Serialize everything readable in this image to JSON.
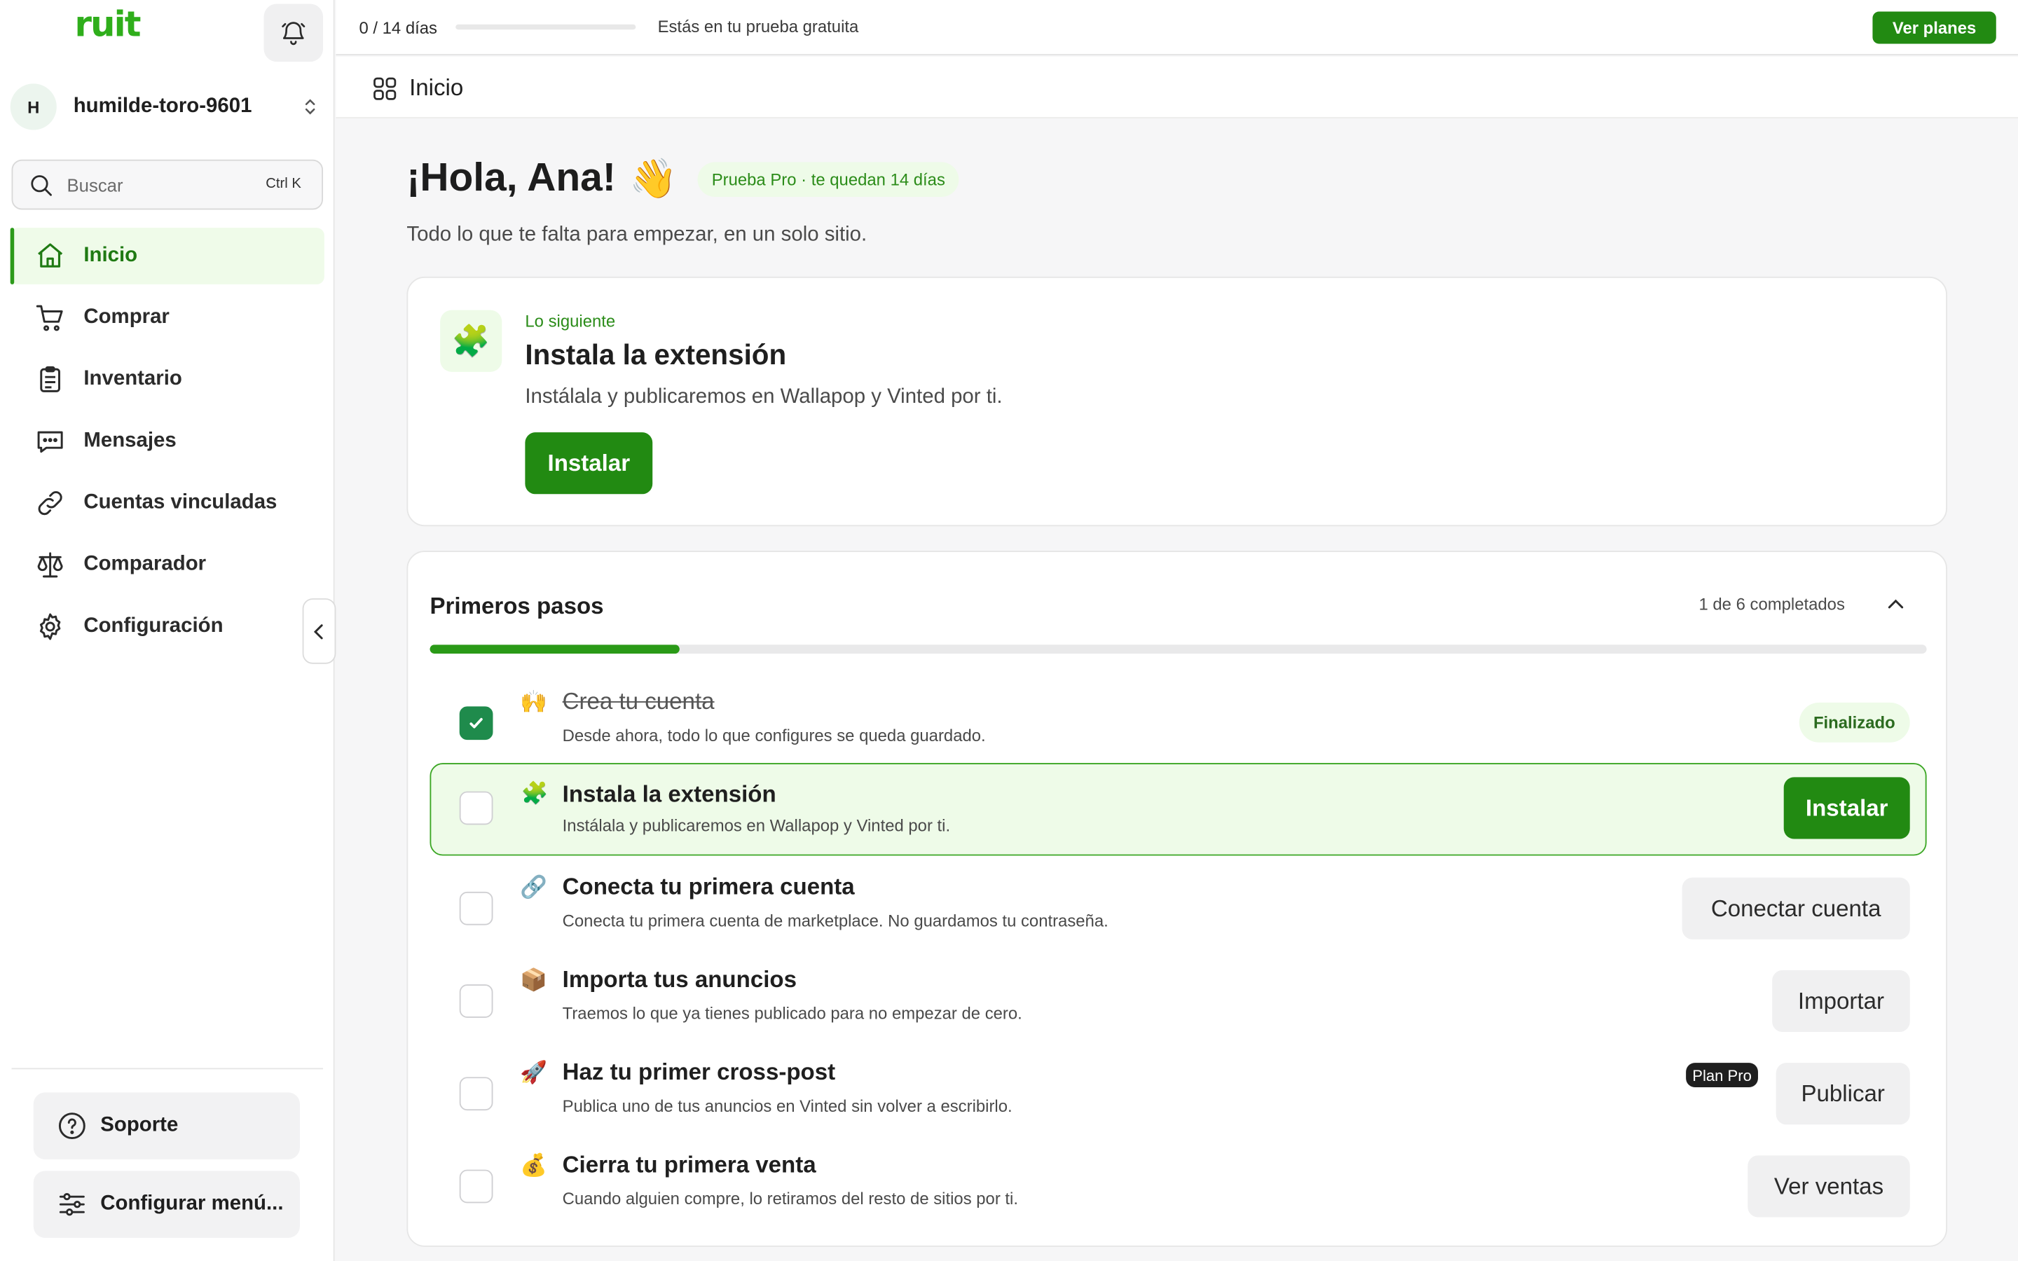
{
  "app": {
    "logo": "ruit"
  },
  "sidebar": {
    "workspace": {
      "avatar": "H",
      "name": "humilde-toro-9601"
    },
    "search": {
      "placeholder": "Buscar",
      "shortcut": "Ctrl K"
    },
    "items": [
      {
        "label": "Inicio",
        "icon": "home-icon",
        "active": true
      },
      {
        "label": "Comprar",
        "icon": "cart-icon"
      },
      {
        "label": "Inventario",
        "icon": "clipboard-icon"
      },
      {
        "label": "Mensajes",
        "icon": "chat-icon"
      },
      {
        "label": "Cuentas vinculadas",
        "icon": "link-icon"
      },
      {
        "label": "Comparador",
        "icon": "scale-icon"
      },
      {
        "label": "Configuración",
        "icon": "gear-icon"
      }
    ],
    "support_label": "Soporte",
    "configure_label": "Configurar menú..."
  },
  "topbar": {
    "trial_count": "0 / 14 días",
    "trial_progress": 0,
    "trial_text": "Estás en tu prueba gratuita",
    "plans_label": "Ver planes"
  },
  "breadcrumb": {
    "label": "Inicio"
  },
  "main": {
    "greeting": "¡Hola, Ana!",
    "greeting_emoji": "👋",
    "pro_badge": "Prueba Pro · te quedan 14 días",
    "subtitle": "Todo lo que te falta para empezar, en un solo sitio.",
    "next": {
      "eyebrow": "Lo siguiente",
      "emoji": "🧩",
      "title": "Instala la extensión",
      "desc": "Instálala y publicaremos en Wallapop y Vinted por ti.",
      "button": "Instalar"
    },
    "steps": {
      "title": "Primeros pasos",
      "count": "1 de 6 completados",
      "progress": 0.1667,
      "items": [
        {
          "emoji": "🙌",
          "title": "Crea tu cuenta",
          "desc": "Desde ahora, todo lo que configures se queda guardado.",
          "done": true,
          "badge": "Finalizado"
        },
        {
          "emoji": "🧩",
          "title": "Instala la extensión",
          "desc": "Instálala y publicaremos en Wallapop y Vinted por ti.",
          "button": "Instalar"
        },
        {
          "emoji": "🔗",
          "title": "Conecta tu primera cuenta",
          "desc": "Conecta tu primera cuenta de marketplace. No guardamos tu contraseña.",
          "button": "Conectar cuenta"
        },
        {
          "emoji": "📦",
          "title": "Importa tus anuncios",
          "desc": "Traemos lo que ya tienes publicado para no empezar de cero.",
          "button": "Importar"
        },
        {
          "emoji": "🚀",
          "title": "Haz tu primer cross-post",
          "desc": "Publica uno de tus anuncios en Vinted sin volver a escribirlo.",
          "button": "Publicar",
          "pill": "Plan Pro"
        },
        {
          "emoji": "💰",
          "title": "Cierra tu primera venta",
          "desc": "Cuando alguien compre, lo retiramos del resto de sitios por ti.",
          "button": "Ver ventas"
        }
      ]
    }
  }
}
